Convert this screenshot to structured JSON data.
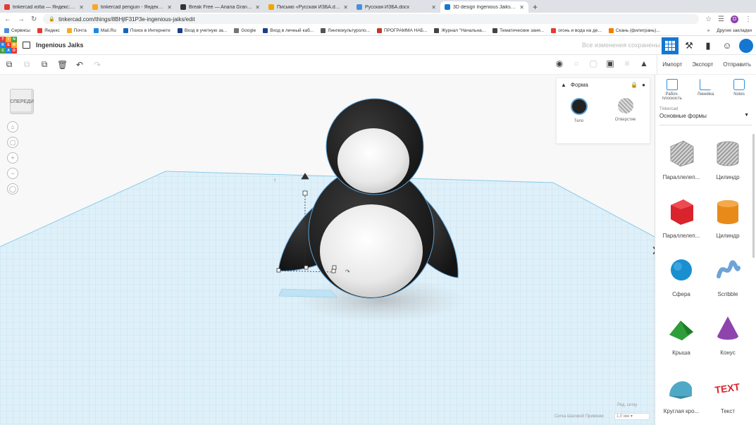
{
  "browser": {
    "tabs": [
      {
        "title": "tinkercad изба — Яндекс: нашло",
        "color": "#e53935",
        "active": false
      },
      {
        "title": "tinkercad penguin - Яндекс.Видео",
        "color": "#f9a825",
        "active": false
      },
      {
        "title": "Break Free — Ariana Grande",
        "color": "#333333",
        "active": false
      },
      {
        "title": "Письмо «Русская ИЗБА.docx» - ",
        "color": "#f0a500",
        "active": false
      },
      {
        "title": "Русская ИЗБА.docx",
        "color": "#4a90d9",
        "active": false
      },
      {
        "title": "3D design Ingenious Jaiks | Tinke",
        "color": "#1477d1",
        "active": true
      }
    ],
    "url": "tinkercad.com/things/8BHjlF31P3e-ingenious-jaiks/edit",
    "profile_initial": "D",
    "bookmarks": [
      {
        "label": "Сервисы",
        "color": "#4a90d9"
      },
      {
        "label": "Яндекс",
        "color": "#e53935"
      },
      {
        "label": "Почта",
        "color": "#f9a825"
      },
      {
        "label": "Mail.Ru",
        "color": "#1e88e5"
      },
      {
        "label": "Поиск в Интернете",
        "color": "#1565c0"
      },
      {
        "label": "Вход в учетную за...",
        "color": "#1a3e8c"
      },
      {
        "label": "Google",
        "color": "#757575"
      },
      {
        "label": "Вход в личный каб...",
        "color": "#1a3e8c"
      },
      {
        "label": "Лингвокультуроло...",
        "color": "#555555"
      },
      {
        "label": "ПРОГРАММА НАБ...",
        "color": "#c0392b"
      },
      {
        "label": "Журнал \"Начальна...",
        "color": "#444444"
      },
      {
        "label": "Тематические заня...",
        "color": "#444444"
      },
      {
        "label": "огонь и вода на де...",
        "color": "#e53935"
      },
      {
        "label": "Скань (филигрань)...",
        "color": "#f57c00"
      }
    ],
    "bookmarks_more": "»",
    "other_bookmarks": "Другие закладки"
  },
  "app": {
    "logo_letters": [
      "TIN",
      "KER",
      "CAD"
    ],
    "title": "Ingenious Jaiks",
    "saved_text": "Все изменения сохранены"
  },
  "toolbar": {
    "import_label": "Импорт",
    "export_label": "Экспорт",
    "send_label": "Отправить"
  },
  "viewcube_label": "СПЕРЕДИ",
  "shape_panel": {
    "title": "Форма",
    "solid_label": "Тело",
    "hole_label": "Отверстие"
  },
  "right_panel": {
    "tabs": [
      {
        "label": "Рабоч. плоскость"
      },
      {
        "label": "Линейка"
      },
      {
        "label": "Notes"
      }
    ],
    "library_source": "Tinkercad",
    "library_name": "Основные формы",
    "shapes": [
      {
        "label": "Параллелеп...",
        "color": "#bfbfbf",
        "icon": "box-hole"
      },
      {
        "label": "Цилиндр",
        "color": "#bfbfbf",
        "icon": "cylinder-hole"
      },
      {
        "label": "Параллелеп...",
        "color": "#d9232d",
        "icon": "box"
      },
      {
        "label": "Цилиндр",
        "color": "#e88a1a",
        "icon": "cylinder"
      },
      {
        "label": "Сфера",
        "color": "#1a8fd0",
        "icon": "sphere"
      },
      {
        "label": "Scribble",
        "color": "#6fa3d6",
        "icon": "scribble"
      },
      {
        "label": "Крыша",
        "color": "#2e9e3a",
        "icon": "roof"
      },
      {
        "label": "Конус",
        "color": "#8e44ad",
        "icon": "cone"
      },
      {
        "label": "Круглая кро...",
        "color": "#4fa9c6",
        "icon": "round-roof"
      },
      {
        "label": "Текст",
        "color": "#d9232d",
        "icon": "text"
      }
    ]
  },
  "workspace": {
    "edit_grid_label": "Ред. сетку",
    "snap_label": "Сетка Шаговой Привязки",
    "snap_value": "1,0 мм"
  }
}
